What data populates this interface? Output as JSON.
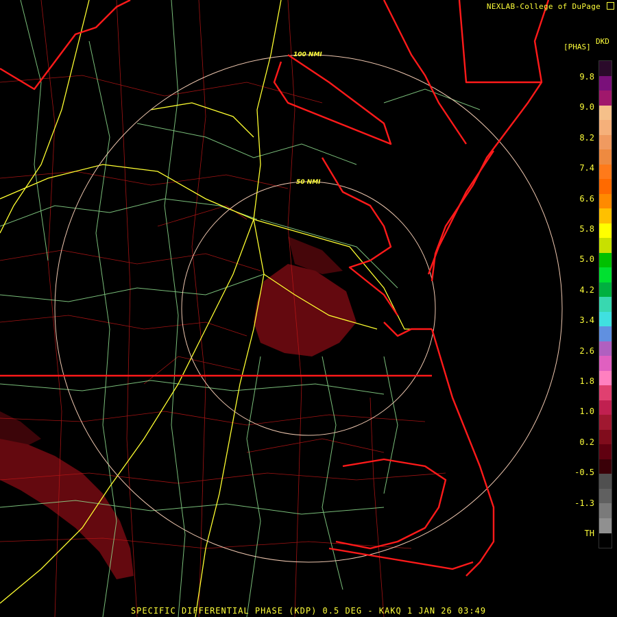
{
  "header": {
    "credit": "NEXLAB-College of DuPage",
    "credit_icon": "external-link-icon",
    "units": "[PHAS]",
    "product_code": "DKD"
  },
  "legend": {
    "ticks": [
      "9.8",
      "9.0",
      "8.2",
      "7.4",
      "6.6",
      "5.8",
      "5.0",
      "4.2",
      "3.4",
      "2.6",
      "1.8",
      "1.0",
      "0.2",
      "-0.5",
      "-1.3",
      "TH"
    ],
    "colors": [
      "#2a0a2a",
      "#7a107a",
      "#a0186c",
      "#f5c08a",
      "#f5b07a",
      "#f09a60",
      "#ee8a40",
      "#ff7a1a",
      "#ff6a00",
      "#ff8a00",
      "#ffc000",
      "#ffff00",
      "#c8e000",
      "#00c000",
      "#00e030",
      "#00b040",
      "#38d8b0",
      "#40e0e0",
      "#6090e0",
      "#b060c0",
      "#e060c0",
      "#ff80c0",
      "#e04070",
      "#c02050",
      "#a01830",
      "#800c1c",
      "#600010",
      "#3a0008",
      "#505050",
      "#606060",
      "#7a7a7a",
      "#909090",
      "#000000"
    ]
  },
  "range_rings": {
    "inner_label": "50 NMI",
    "outer_label": "100 NMI"
  },
  "colors": {
    "state_border": "#ff1a1a",
    "county_line": "#c01818",
    "highway": "#ffff30",
    "road": "#90e090",
    "range_ring": "#f0c8b0",
    "echo": "#6a0a10",
    "label": "#ffff3a"
  },
  "footer": {
    "caption": "SPECIFIC DIFFERENTIAL PHASE (KDP) 0.5 DEG - KAKQ 1 JAN 26 03:49"
  }
}
